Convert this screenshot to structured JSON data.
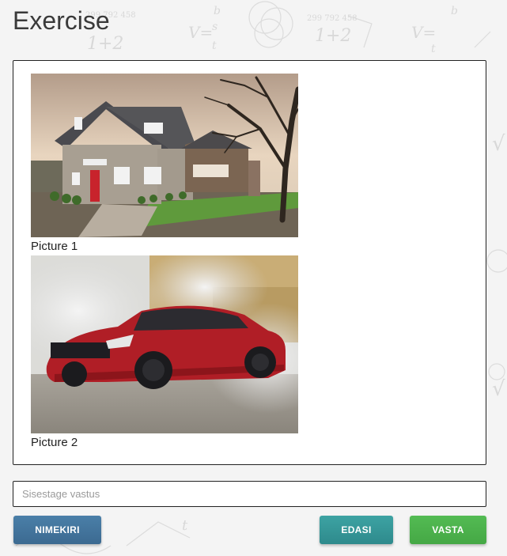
{
  "page": {
    "title": "Exercise"
  },
  "exercise": {
    "pictures": [
      {
        "caption": "Picture 1",
        "image": "house-photo"
      },
      {
        "caption": "Picture 2",
        "image": "red-sports-car-photo"
      }
    ]
  },
  "answer_input": {
    "placeholder": "Sisestage vastus",
    "value": ""
  },
  "buttons": {
    "list_label": "NIMEKIRI",
    "next_label": "EDASI",
    "answer_label": "VASTA"
  },
  "colors": {
    "list_button": "#3f6f97",
    "next_button": "#349696",
    "answer_button": "#4cb14c"
  }
}
